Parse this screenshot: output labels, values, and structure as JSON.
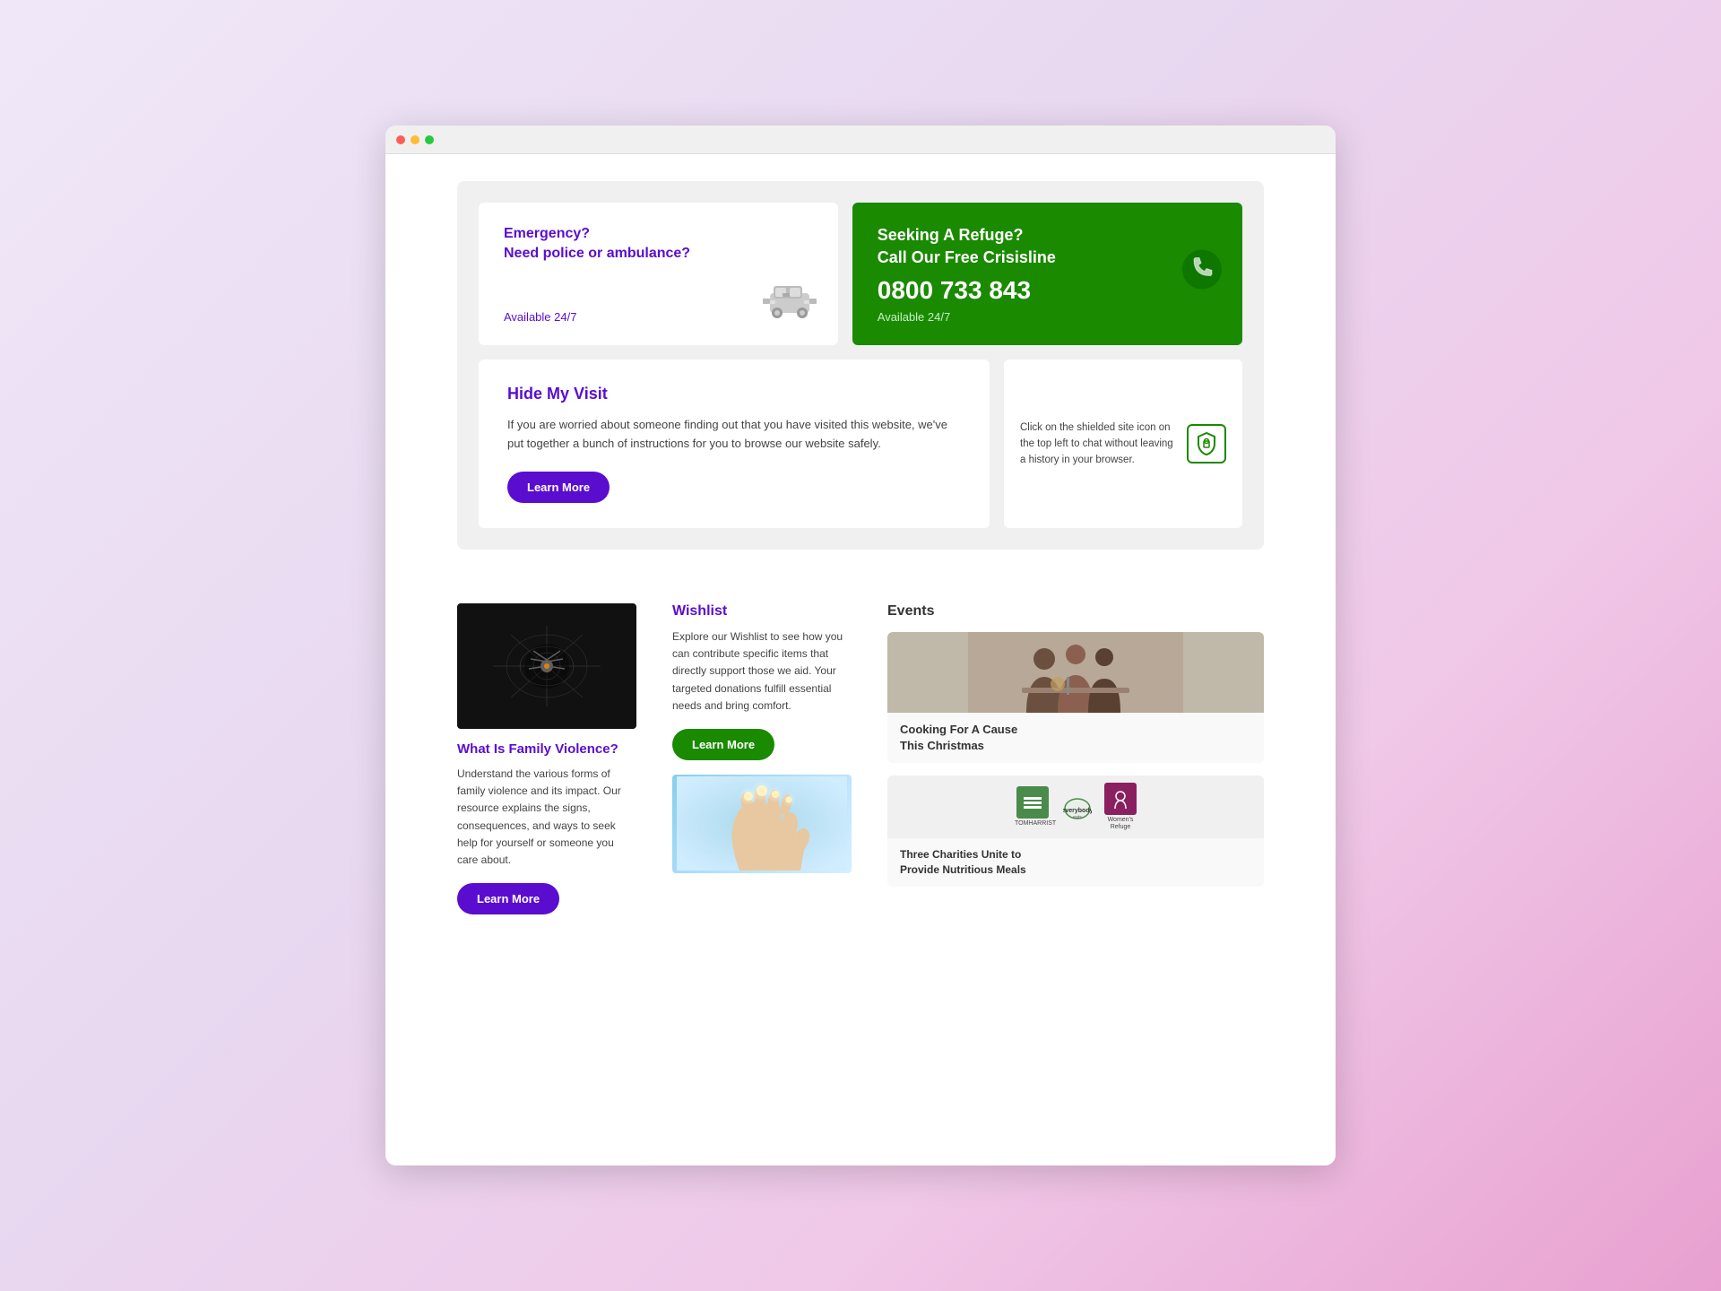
{
  "browser": {
    "dots": [
      "red",
      "yellow",
      "green"
    ]
  },
  "emergency": {
    "police_title": "Emergency?\nNeed police or ambulance?",
    "police_available": "Available 24/7",
    "refuge_title": "Seeking A Refuge?\nCall Our Free Crisisline",
    "refuge_phone": "0800 733 843",
    "refuge_available": "Available 24/7"
  },
  "hide_visit": {
    "title": "Hide My Visit",
    "description": "If you are worried about someone finding out that you have visited this website, we've put together a bunch of instructions for you to browse our website safely.",
    "learn_more": "Learn More",
    "side_instruction": "Click on the shielded site icon on the top left to chat without leaving a history in your browser."
  },
  "family_violence": {
    "title": "What Is Family Violence?",
    "description": "Understand the various forms of family violence and its impact. Our resource explains the signs, consequences, and ways to seek help for yourself or someone you care about.",
    "learn_more": "Learn More"
  },
  "wishlist": {
    "title": "Wishlist",
    "description": "Explore our Wishlist to see how you can contribute specific items that directly support those we aid. Your targeted donations fulfill essential needs and bring comfort.",
    "learn_more": "Learn More"
  },
  "events": {
    "title": "Events",
    "event1": {
      "label": "Cooking For A Cause\nThis Christmas"
    },
    "event2": {
      "title": "Three Charities Unite to\nProvide Nutritious Meals",
      "logos": [
        "Tomharrist",
        "everybody\neats",
        "Women's\nRefuge"
      ]
    }
  }
}
